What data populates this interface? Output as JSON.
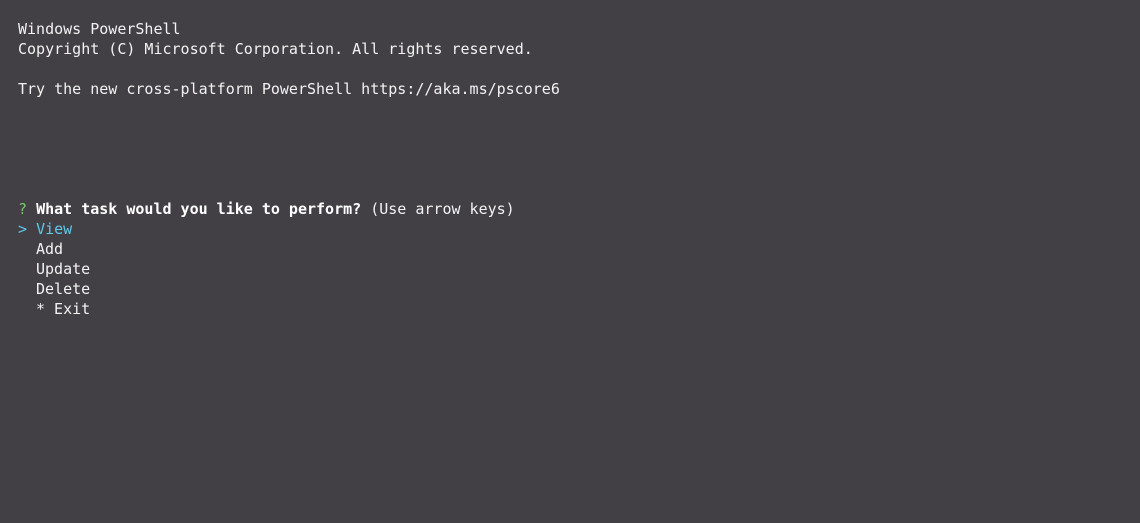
{
  "window": {
    "theme": {
      "background": "#424045",
      "foreground": "#f2f2f2",
      "prompt_mark_color": "#7cc56a",
      "selected_color": "#61c7e4"
    }
  },
  "banner": {
    "line1": "Windows PowerShell",
    "line2": "Copyright (C) Microsoft Corporation. All rights reserved.",
    "line3": "Try the new cross-platform PowerShell https://aka.ms/pscore6"
  },
  "prompt": {
    "mark": "?",
    "question": "What task would you like to perform?",
    "hint": "(Use arrow keys)",
    "pointer": ">",
    "options": [
      {
        "label": "View",
        "selected": true
      },
      {
        "label": "Add",
        "selected": false
      },
      {
        "label": "Update",
        "selected": false
      },
      {
        "label": "Delete",
        "selected": false
      },
      {
        "label": "* Exit",
        "selected": false
      }
    ]
  }
}
